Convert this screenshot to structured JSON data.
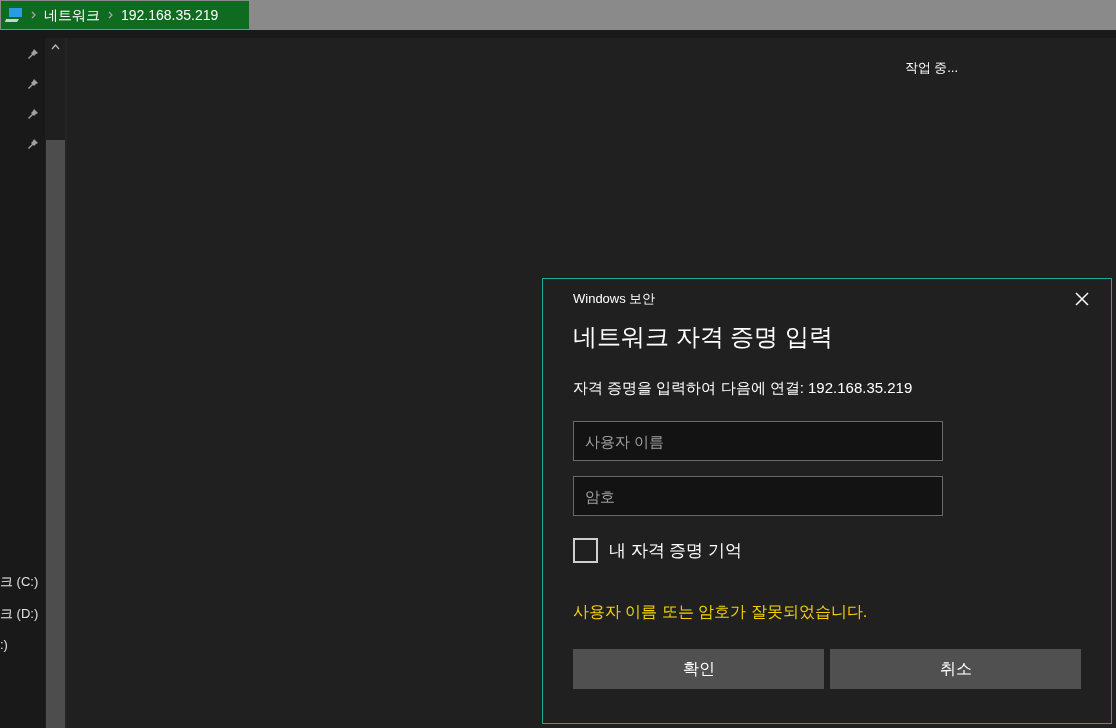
{
  "address_bar": {
    "breadcrumbs": [
      "네트워크",
      "192.168.35.219"
    ]
  },
  "navigation": {
    "pinned_count_items": [
      {
        "pinned": true
      },
      {
        "pinned": true
      },
      {
        "pinned": true
      },
      {
        "pinned": true
      }
    ],
    "drives": [
      "크 (C:)",
      "크 (D:)",
      ":)"
    ]
  },
  "content": {
    "status": "작업 중..."
  },
  "dialog": {
    "app_title": "Windows 보안",
    "title": "네트워크 자격 증명 입력",
    "message": "자격 증명을 입력하여 다음에 연결: 192.168.35.219",
    "fields": [
      {
        "placeholder": "사용자 이름"
      },
      {
        "placeholder": "암호"
      }
    ],
    "remember": {
      "label": "내 자격 증명 기억",
      "checked": false
    },
    "error": "사용자 이름 또는 암호가 잘못되었습니다.",
    "buttons": [
      "확인",
      "취소"
    ]
  }
}
